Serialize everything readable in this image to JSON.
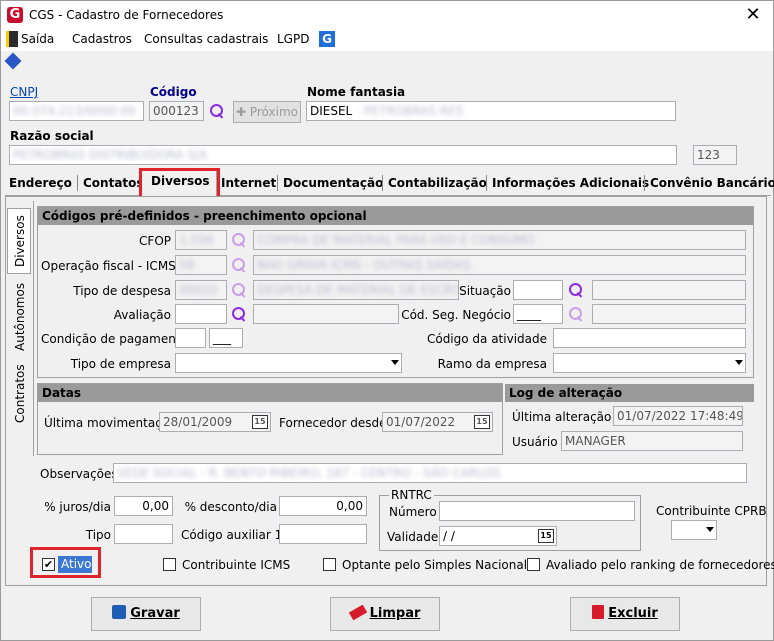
{
  "window": {
    "title": "CGS - Cadastro de Fornecedores",
    "close": "✕"
  },
  "menu": {
    "saida": "Saída",
    "cadastros": "Cadastros",
    "consultas": "Consultas cadastrais",
    "lgpd": "LGPD"
  },
  "header": {
    "cnpj_label": "CNPJ",
    "cnpj_value": "00.074.213/0000-00",
    "codigo_label": "Código",
    "codigo_value": "000123",
    "proximo_label": "Próximo",
    "nome_label": "Nome fantasia",
    "nome_value": "DIESEL",
    "nome_value_blur": "- PETROBRAS RES",
    "razao_label": "Razão social",
    "razao_value": "PETROBRAS DISTRIBUIDORA S/A",
    "razao_code": "123"
  },
  "tabs": [
    "Endereço",
    "Contatos",
    "Diversos",
    "Internet",
    "Documentação",
    "Contabilização",
    "Informações Adicionais",
    "Convênio Bancário"
  ],
  "side_tabs": [
    "Diversos",
    "Autônomos",
    "Contratos"
  ],
  "codigos": {
    "title": "Códigos pré-definidos - preenchimento opcional",
    "cfop_label": "CFOP",
    "cfop_code": "1.556",
    "cfop_desc": "COMPRA DE MATERIAL PARA USO E CONSUMO",
    "op_label": "Operação fiscal - ICMS",
    "op_code": "58",
    "op_desc": "NAO GRAVA ICMS - OUTRAS SAÍDAS",
    "despesa_label": "Tipo de despesa",
    "despesa_code": "00020",
    "despesa_desc": "DESPESA DE MATERIAL DE ESCRITÓRIO",
    "situacao_label": "Situação",
    "avaliacao_label": "Avaliação",
    "codseg_label": "Cód. Seg. Negócio",
    "codseg_value": "____",
    "cond_label": "Condição de pagamento",
    "cond_value": "___",
    "atividade_label": "Código da atividade",
    "tipoemp_label": "Tipo de empresa",
    "ramo_label": "Ramo da empresa"
  },
  "datas": {
    "title": "Datas",
    "ultmov_label": "Última movimentação",
    "ultmov_value": "28/01/2009",
    "fornecedor_label": "Fornecedor desde",
    "fornecedor_value": "01/07/2022",
    "cal_icon": "15"
  },
  "log": {
    "title": "Log de alteração",
    "ultalt_label": "Última alteração",
    "ultalt_value": "01/07/2022 17:48:49",
    "usuario_label": "Usuário",
    "usuario_value": "MANAGER"
  },
  "obs": {
    "label": "Observações",
    "value": "SEDE SOCIAL - R. BENTO RIBEIRO, 187 - CENTRO - SÃO CARLOS"
  },
  "financeiro": {
    "juros_label": "% juros/dia",
    "juros_value": "0,00",
    "desconto_label": "% desconto/dia",
    "desconto_value": "0,00",
    "tipo_label": "Tipo",
    "codaux_label": "Código auxiliar 1"
  },
  "rntrc": {
    "title": "RNTRC",
    "numero_label": "Número",
    "validade_label": "Validade",
    "validade_value": " /  /"
  },
  "cprb": {
    "label": "Contribuinte CPRB"
  },
  "checks": {
    "ativo": "Ativo",
    "contrib_icms": "Contribuinte ICMS",
    "simples": "Optante pelo Simples Nacional",
    "ranking": "Avaliado pelo ranking de fornecedores"
  },
  "buttons": {
    "gravar": "Gravar",
    "limpar": "Limpar",
    "excluir": "Excluir"
  },
  "colors": {
    "highlight": "#e0242b",
    "section_header": "#9a9a9a",
    "magnifier": "#8a2be2"
  }
}
